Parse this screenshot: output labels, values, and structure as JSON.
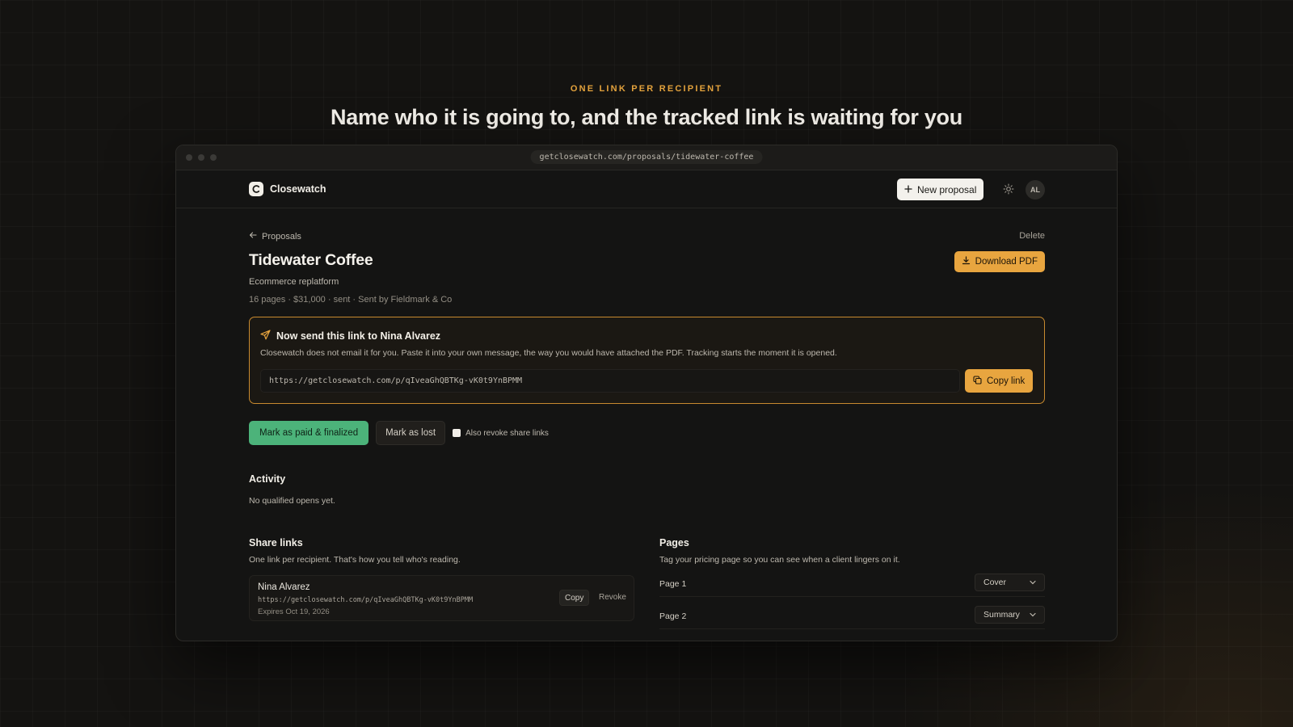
{
  "hero": {
    "eyebrow": "ONE LINK PER RECIPIENT",
    "headline": "Name who it is going to, and the tracked link is waiting for you"
  },
  "browser": {
    "url": "getclosewatch.com/proposals/tidewater-coffee"
  },
  "nav": {
    "brand": "Closewatch",
    "new_proposal_label": "New proposal",
    "avatar_initials": "AL"
  },
  "proposal": {
    "back_label": "Proposals",
    "delete_label": "Delete",
    "title": "Tidewater Coffee",
    "subtitle": "Ecommerce replatform",
    "meta": "16 pages · $31,000 · sent · Sent by Fieldmark & Co",
    "download_label": "Download PDF"
  },
  "send_box": {
    "title": "Now send this link to Nina Alvarez",
    "description": "Closewatch does not email it for you. Paste it into your own message, the way you would have attached the PDF. Tracking starts the moment it is opened.",
    "link": "https://getclosewatch.com/p/qIveaGhQBTKg-vK0t9YnBPMM",
    "copy_label": "Copy link"
  },
  "actions": {
    "paid_label": "Mark as paid & finalized",
    "lost_label": "Mark as lost",
    "revoke_checkbox_label": "Also revoke share links",
    "revoke_checked": false
  },
  "activity": {
    "heading": "Activity",
    "empty_text": "No qualified opens yet."
  },
  "share_links": {
    "heading": "Share links",
    "subtitle": "One link per recipient. That's how you tell who's reading.",
    "items": [
      {
        "name": "Nina Alvarez",
        "url": "https://getclosewatch.com/p/qIveaGhQBTKg-vK0t9YnBPMM",
        "expires": "Expires Oct 19, 2026",
        "copy_label": "Copy",
        "revoke_label": "Revoke"
      }
    ]
  },
  "pages": {
    "heading": "Pages",
    "subtitle": "Tag your pricing page so you can see when a client lingers on it.",
    "rows": [
      {
        "label": "Page 1",
        "tag": "Cover"
      },
      {
        "label": "Page 2",
        "tag": "Summary"
      }
    ]
  },
  "colors": {
    "accent": "#e8a53f",
    "success": "#4cb37a",
    "background": "#141311"
  }
}
